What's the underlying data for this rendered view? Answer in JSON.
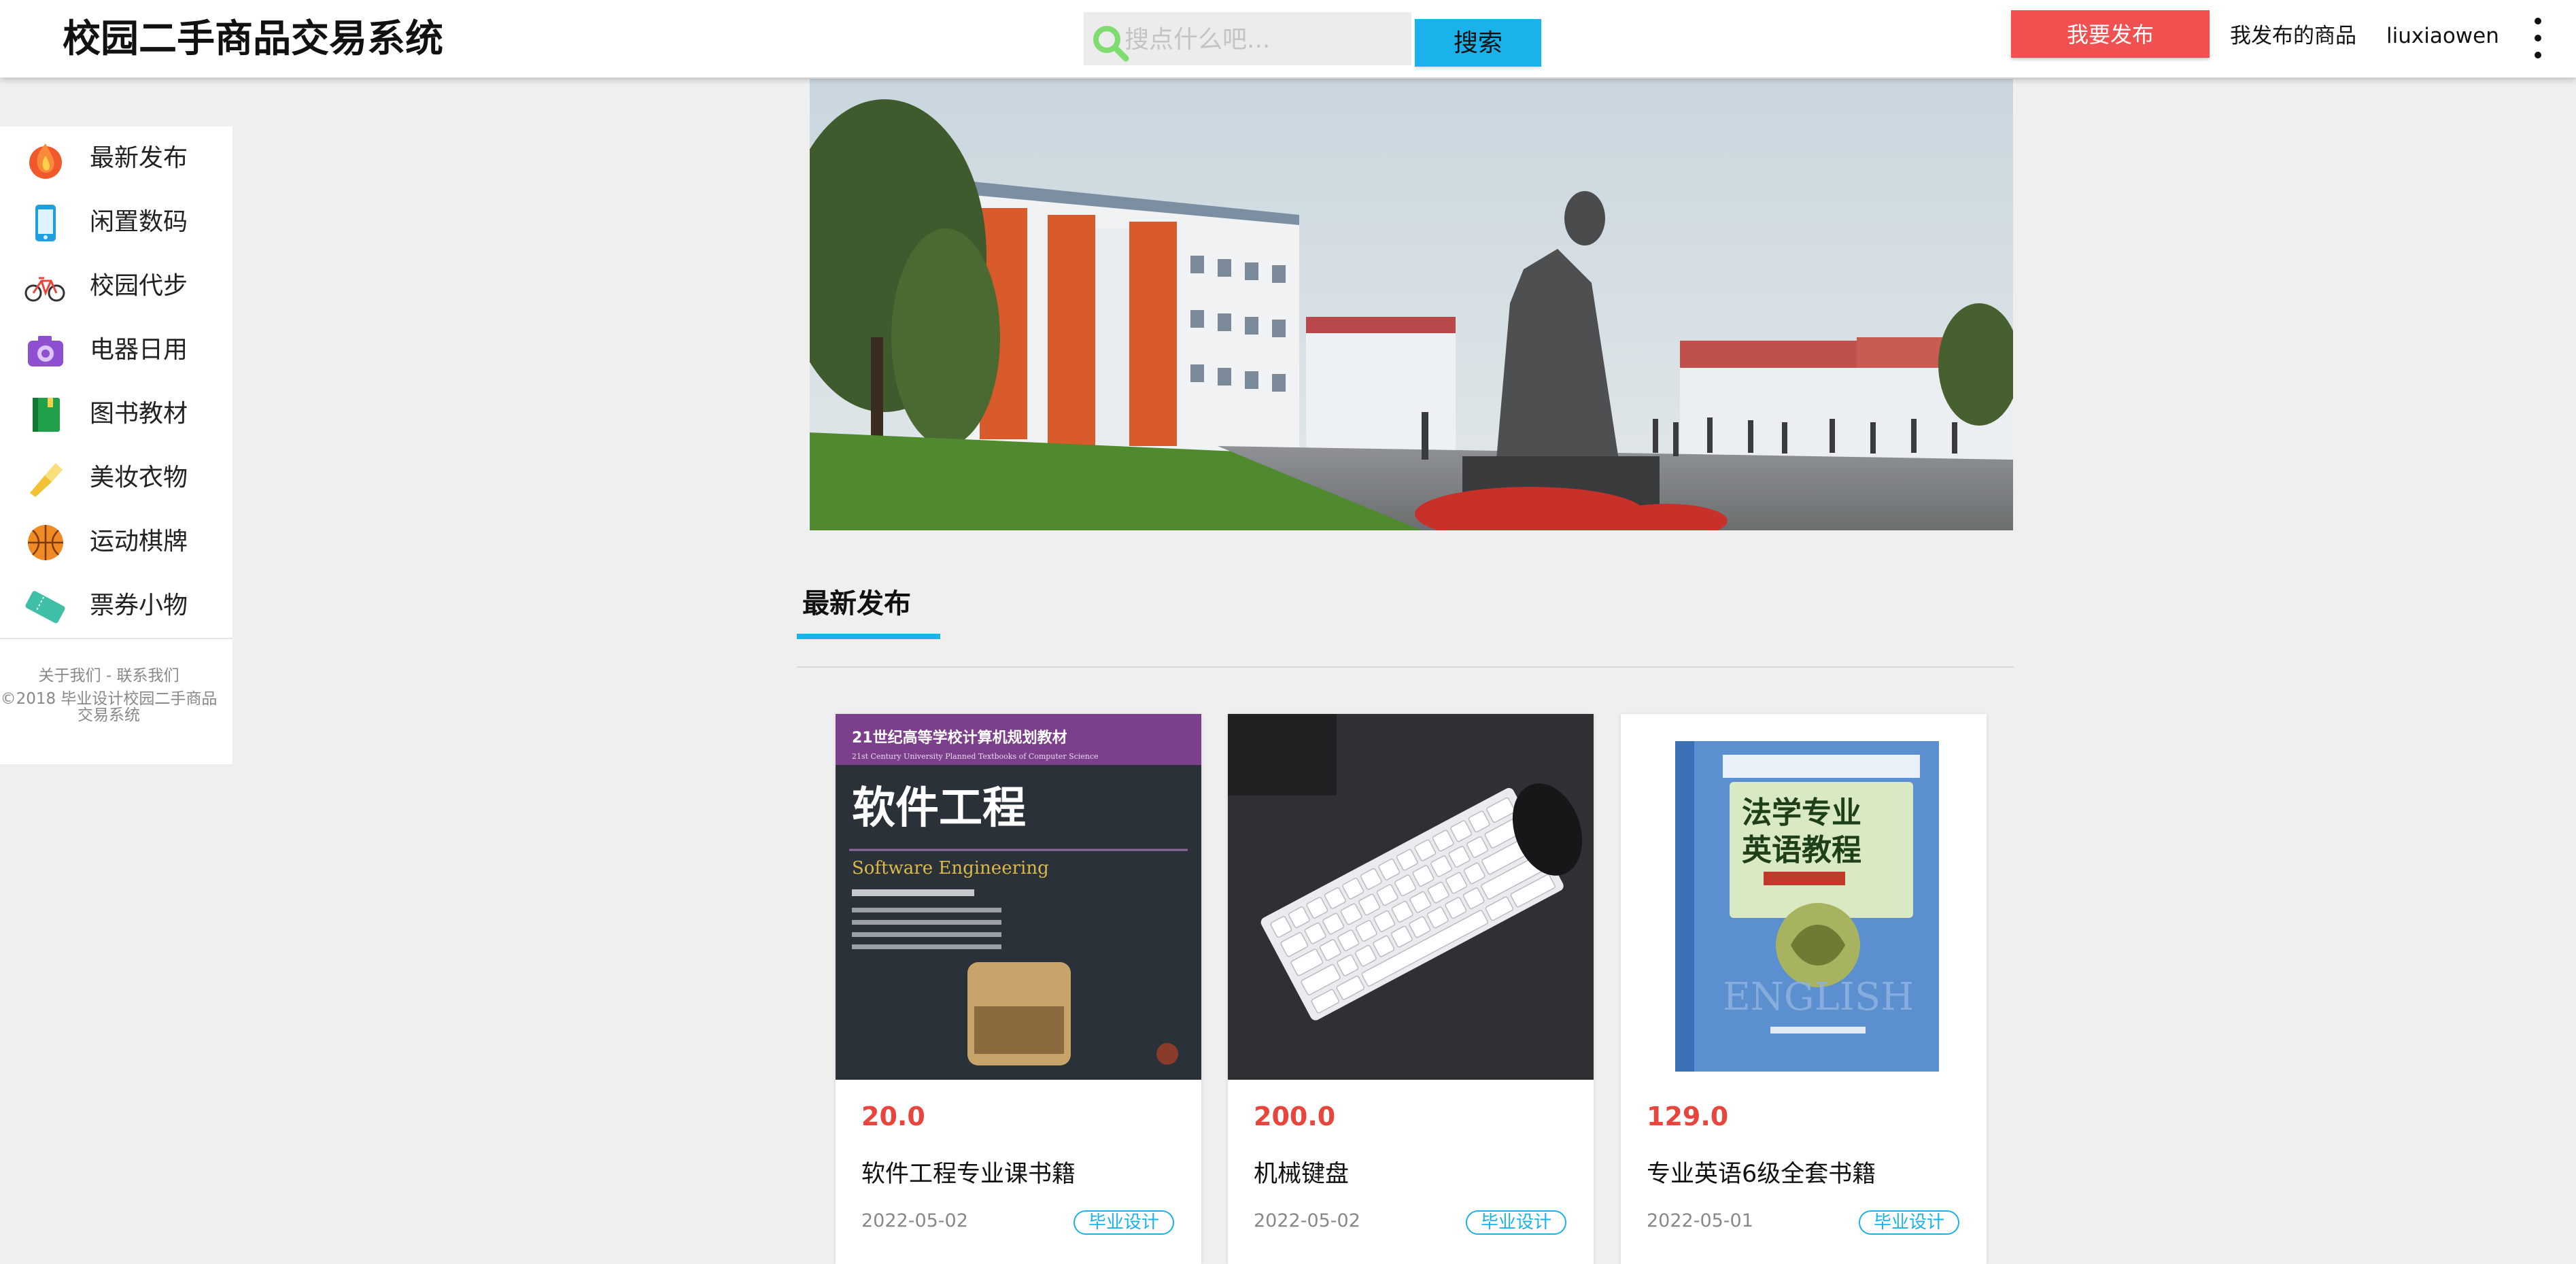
{
  "app": {
    "title": "校园二手商品交易系统"
  },
  "colors": {
    "accent": "#1ab2ea",
    "publish": "#f05050",
    "price": "#e8463c"
  },
  "search": {
    "placeholder": "搜点什么吧...",
    "value": "",
    "button_label": "搜索",
    "icon": "search-icon"
  },
  "header_right": {
    "publish_label": "我要发布",
    "my_goods_label": "我发布的商品",
    "username": "liuxiaowen",
    "menu_icon": "more-vertical-icon"
  },
  "sidebar": {
    "items": [
      {
        "label": "最新发布",
        "icon": "fire-icon"
      },
      {
        "label": "闲置数码",
        "icon": "phone-icon"
      },
      {
        "label": "校园代步",
        "icon": "bicycle-icon"
      },
      {
        "label": "电器日用",
        "icon": "camera-icon"
      },
      {
        "label": "图书教材",
        "icon": "book-icon"
      },
      {
        "label": "美妆衣物",
        "icon": "lipstick-icon"
      },
      {
        "label": "运动棋牌",
        "icon": "basketball-icon"
      },
      {
        "label": "票券小物",
        "icon": "ticket-icon"
      }
    ],
    "footer_links": "关于我们 - 联系我们",
    "footer_copyright": "©2018 毕业设计校园二手商品交易系统"
  },
  "banner": {
    "image": "campus-banner-photo"
  },
  "section": {
    "title": "最新发布"
  },
  "products": [
    {
      "price": "20.0",
      "title": "软件工程专业课书籍",
      "date": "2022-05-02",
      "tag": "毕业设计",
      "image": "book-cover-software-engineering",
      "cover_series": "21世纪高等学校计算机规划教材",
      "cover_series_en": "21st Century University Planned Textbooks of Computer Science",
      "cover_title": "软件工程",
      "cover_subtitle": "Software Engineering"
    },
    {
      "price": "200.0",
      "title": "机械键盘",
      "date": "2022-05-02",
      "tag": "毕业设计",
      "image": "mechanical-keyboard-photo"
    },
    {
      "price": "129.0",
      "title": "专业英语6级全套书籍",
      "date": "2022-05-01",
      "tag": "毕业设计",
      "image": "book-cover-legal-english",
      "cover_title_1": "法学专业",
      "cover_title_2": "英语教程",
      "cover_word": "ENGLISH"
    }
  ]
}
